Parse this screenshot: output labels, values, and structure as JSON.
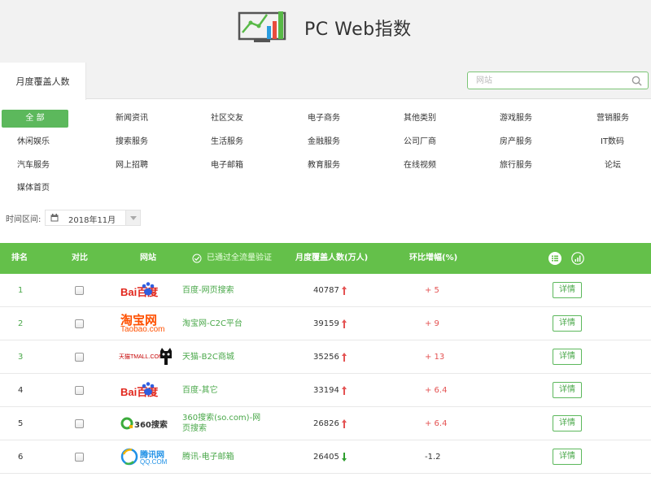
{
  "header": {
    "title": "PC Web指数",
    "logo_icon": "chart-screen-icon"
  },
  "tabs": [
    {
      "label": "月度覆盖人数",
      "active": true
    }
  ],
  "search": {
    "placeholder": "网站",
    "icon": "search-icon"
  },
  "categories": [
    [
      "全 部",
      "新闻资讯",
      "社区交友",
      "电子商务",
      "其他类别",
      "游戏服务",
      "营销服务"
    ],
    [
      "休闲娱乐",
      "搜索服务",
      "生活服务",
      "金融服务",
      "公司厂商",
      "房产服务",
      "IT数码"
    ],
    [
      "汽车服务",
      "网上招聘",
      "电子邮箱",
      "教育服务",
      "在线视频",
      "旅行服务",
      "论坛"
    ],
    [
      "媒体首页"
    ]
  ],
  "time": {
    "label": "时间区间:",
    "value": "2018年11月"
  },
  "table": {
    "headers": {
      "rank": "排名",
      "compare": "对比",
      "site": "网站",
      "verified": "已通过全流量验证",
      "coverage": "月度覆盖人数(万人)",
      "change": "环比增幅(%)"
    },
    "rows": [
      {
        "rank": "1",
        "logo": "baidu-logo",
        "site": "百度-网页搜索",
        "coverage": "40787",
        "trend": "up",
        "change": "+ 5",
        "detail": "详情"
      },
      {
        "rank": "2",
        "logo": "taobao-logo",
        "site": "淘宝网-C2C平台",
        "coverage": "39159",
        "trend": "up",
        "change": "+ 9",
        "detail": "详情"
      },
      {
        "rank": "3",
        "logo": "tmall-logo",
        "site": "天猫-B2C商城",
        "coverage": "35256",
        "trend": "up",
        "change": "+ 13",
        "detail": "详情"
      },
      {
        "rank": "4",
        "logo": "baidu-logo",
        "site": "百度-其它",
        "coverage": "33194",
        "trend": "up",
        "change": "+ 6.4",
        "detail": "详情"
      },
      {
        "rank": "5",
        "logo": "360-search-logo",
        "site": "360搜索(so.com)-网页搜索",
        "coverage": "26826",
        "trend": "up",
        "change": "+ 6.4",
        "detail": "详情"
      },
      {
        "rank": "6",
        "logo": "qq-com-logo",
        "site": "腾讯-电子邮箱",
        "coverage": "26405",
        "trend": "down",
        "change": "-1.2",
        "detail": "详情"
      }
    ]
  },
  "logos": {
    "baidu": "Bai百度",
    "taobao_cn": "淘宝网",
    "taobao_en": "Taobao.com",
    "tmall": "天猫TMALL.COM",
    "s360": "360搜索",
    "qq_cn": "腾讯网",
    "qq_en": "QQ.COM"
  },
  "colors": {
    "accent": "#64c04a",
    "link": "#4aa84a",
    "up": "#e45353",
    "down": "#2e9e2e"
  }
}
